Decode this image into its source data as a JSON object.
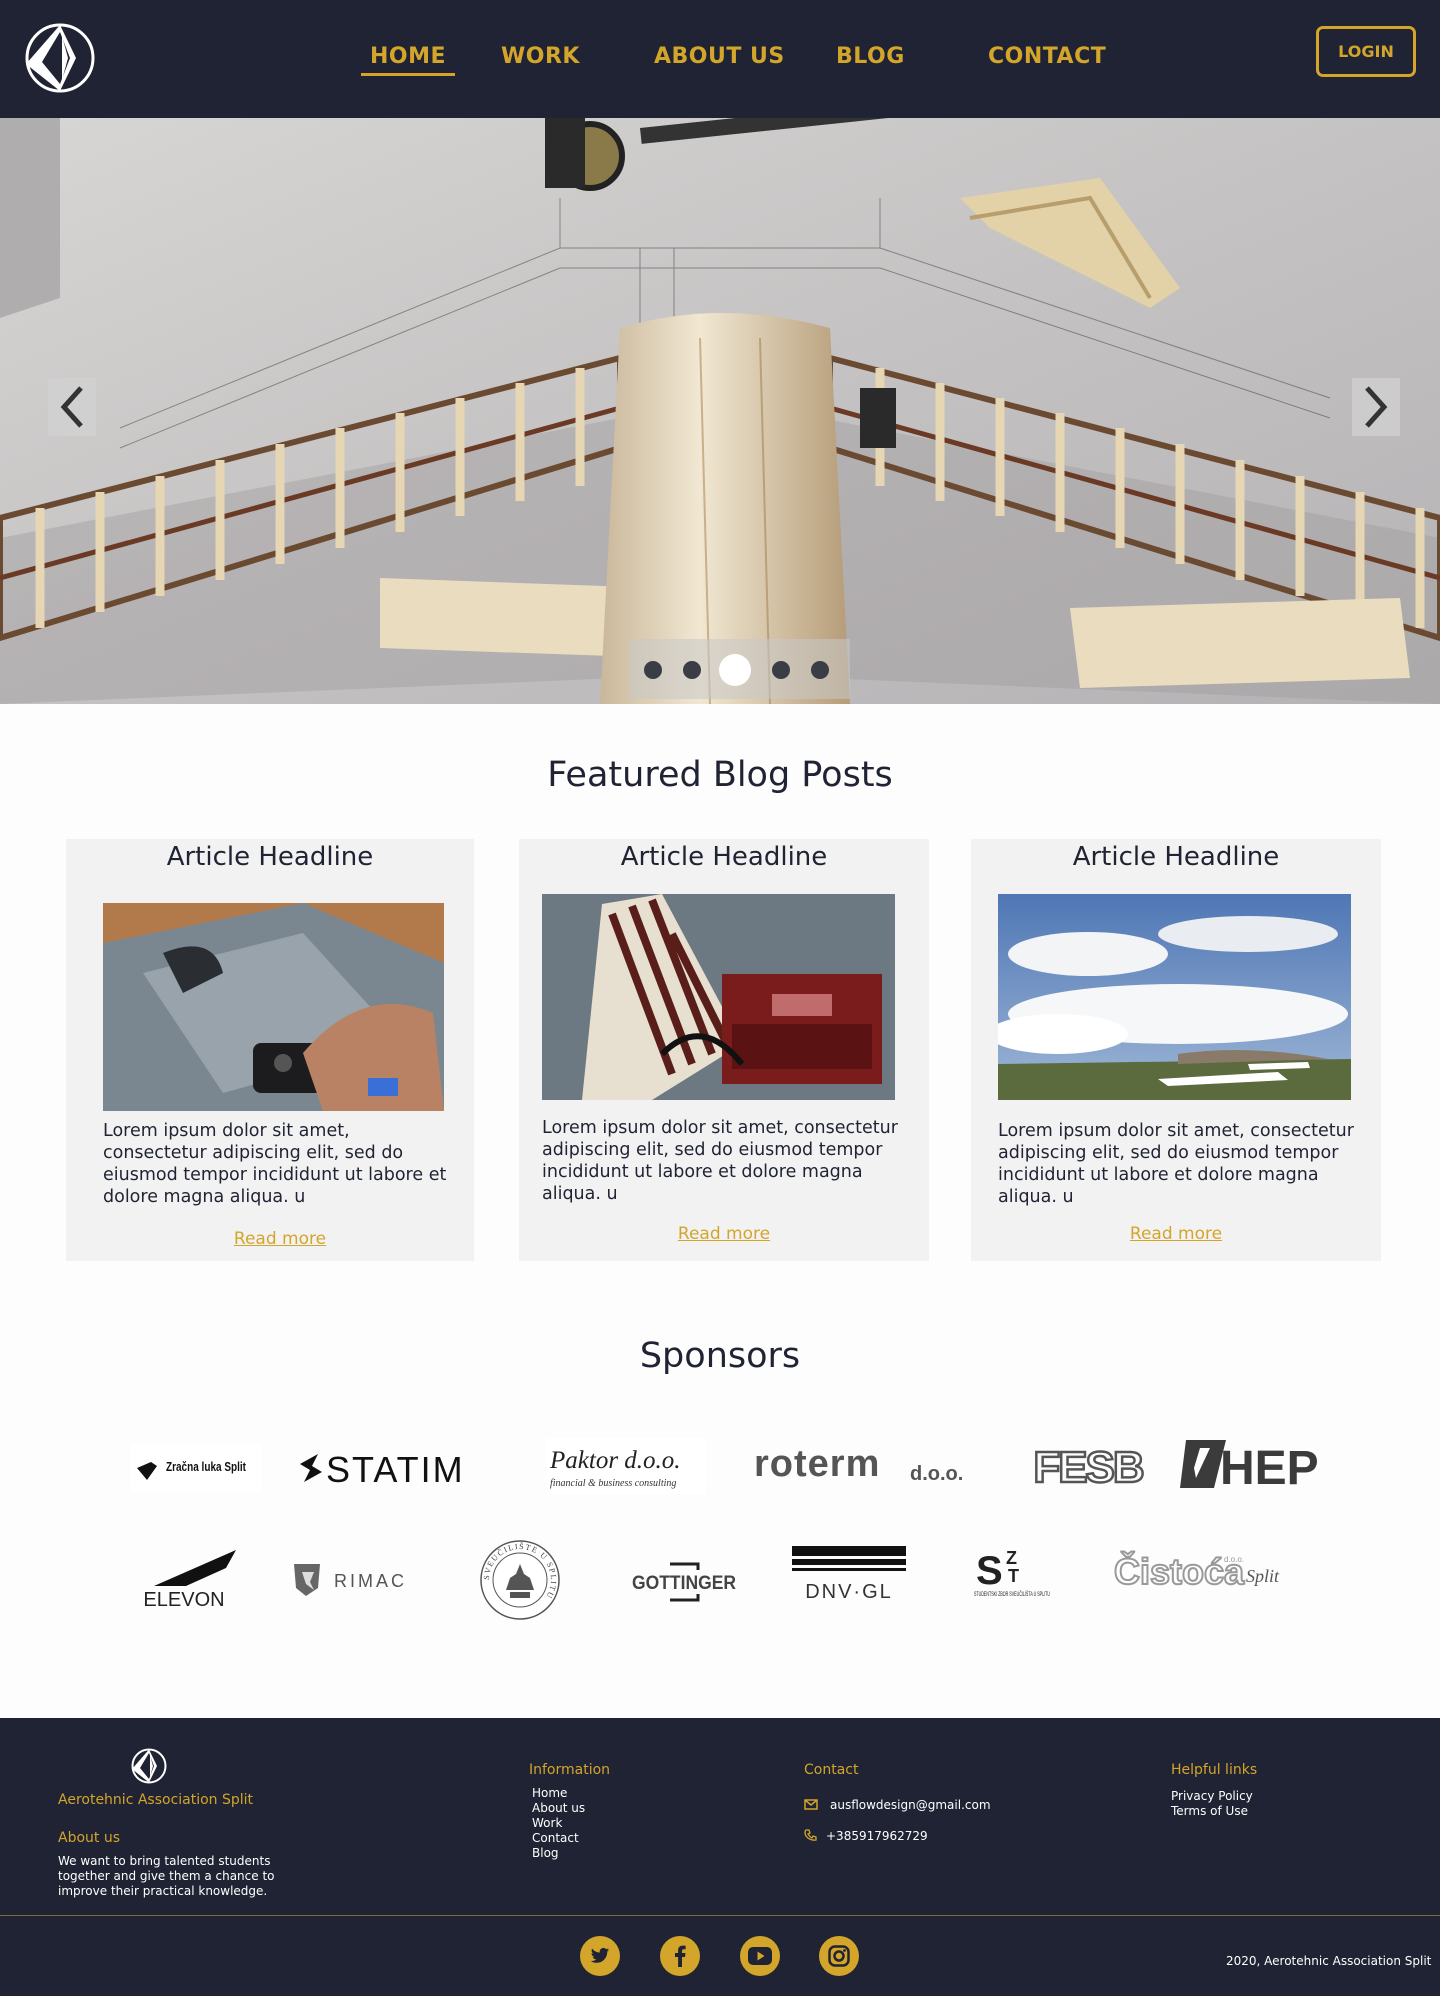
{
  "header": {
    "nav": [
      "HOME",
      "WORK",
      "ABOUT US",
      "BLOG",
      "CONTACT"
    ],
    "login": "LOGIN"
  },
  "hero": {
    "slide_count": 5,
    "active_slide": 3
  },
  "blog": {
    "title": "Featured Blog Posts",
    "posts": [
      {
        "headline": "Article Headline",
        "text": "Lorem ipsum dolor sit amet, consectetur adipiscing elit, sed do eiusmod tempor incididunt ut labore et dolore magna aliqua. u",
        "link": "Read more"
      },
      {
        "headline": "Article Headline",
        "text": "Lorem ipsum dolor sit amet, consectetur adipiscing elit, sed do eiusmod tempor incididunt ut labore et dolore magna aliqua. u",
        "link": "Read more"
      },
      {
        "headline": "Article Headline",
        "text": "Lorem ipsum dolor sit amet, consectetur adipiscing elit, sed do eiusmod tempor incididunt ut labore et dolore magna aliqua. u",
        "link": "Read more"
      }
    ]
  },
  "sponsors": {
    "title": "Sponsors",
    "logos": [
      "Zračna luka Split",
      "STATIM",
      "Paktor d.o.o.",
      "financial & business consulting",
      "roterm",
      "d.o.o.",
      "FESB",
      "HEP",
      "ELEVON",
      "RIMAC",
      "SVEUČILIŠTE U SPLITU",
      "GOTTINGER",
      "DNV·GL",
      "STUDENTSKI ZBOR SVEUČILIŠTA U SPLITU",
      "Čistoća",
      "d.o.o.",
      "Split"
    ]
  },
  "footer": {
    "org_name": "Aerotehnic Association Split",
    "about_title": "About us",
    "about_text": [
      "We want to bring talented students",
      "together and give them a chance to",
      "improve their practical knowledge."
    ],
    "info_title": "Information",
    "info_links": [
      "Home",
      "About us",
      "Work",
      "Contact",
      "Blog"
    ],
    "contact_title": "Contact",
    "email": "ausflowdesign@gmail.com",
    "phone": "+385917962729",
    "helpful_title": "Helpful links",
    "helpful_links": [
      "Privacy Policy",
      "Terms of Use"
    ],
    "copyright": "2020, Aerotehnic Association Split"
  },
  "colors": {
    "navy": "#1f2333",
    "gold": "#d3a52b",
    "card": "#f2f2f2"
  },
  "icons": [
    "logo-icon",
    "arrow-left-icon",
    "arrow-right-icon",
    "email-icon",
    "phone-icon",
    "twitter-icon",
    "facebook-icon",
    "youtube-icon",
    "instagram-icon"
  ]
}
